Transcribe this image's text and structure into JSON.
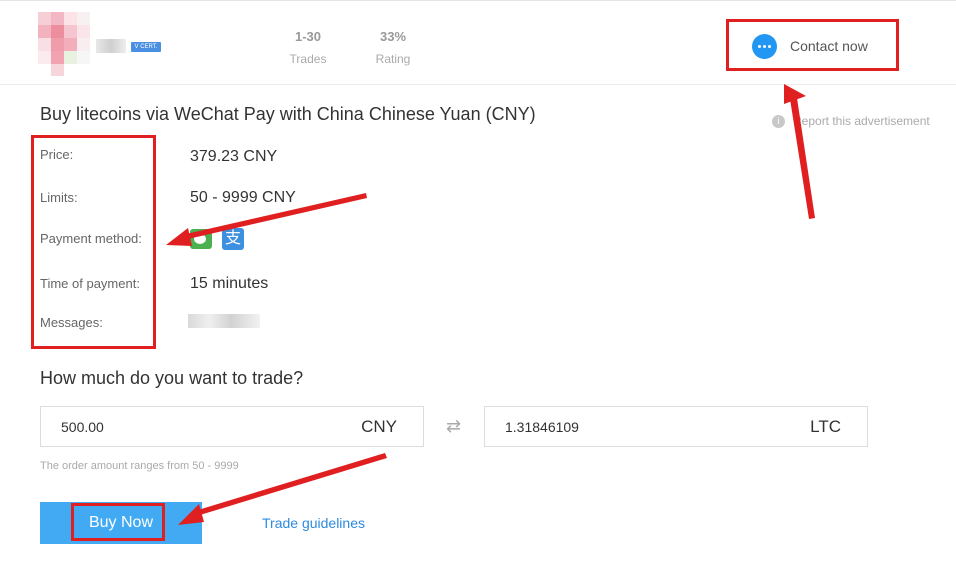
{
  "header": {
    "cert_badge": "V CERT.",
    "stats": [
      {
        "value": "1-30",
        "label": "Trades"
      },
      {
        "value": "33%",
        "label": "Rating"
      }
    ],
    "contact_label": "Contact now"
  },
  "ad": {
    "title": "Buy litecoins via WeChat Pay with China Chinese Yuan (CNY)",
    "report_label": "Report this advertisement",
    "price_label": "Price:",
    "price_value": "379.23 CNY",
    "limits_label": "Limits:",
    "limits_value": "50 - 9999 CNY",
    "payment_label": "Payment method:",
    "payment_icons": [
      "wechat-pay-icon",
      "alipay-icon"
    ],
    "time_label": "Time of payment:",
    "time_value": "15 minutes",
    "messages_label": "Messages:"
  },
  "trade": {
    "question": "How much do you want to trade?",
    "amount_value": "500.00",
    "amount_currency": "CNY",
    "crypto_value": "1.31846109",
    "crypto_currency": "LTC",
    "swap_icon": "⇄",
    "hint": "The order amount ranges from 50 - 9999",
    "buy_label": "Buy Now",
    "guidelines_label": "Trade guidelines"
  },
  "colors": {
    "accent_blue": "#42aaf3",
    "annotation_red": "#e02020",
    "link_blue": "#2d8ae0"
  }
}
